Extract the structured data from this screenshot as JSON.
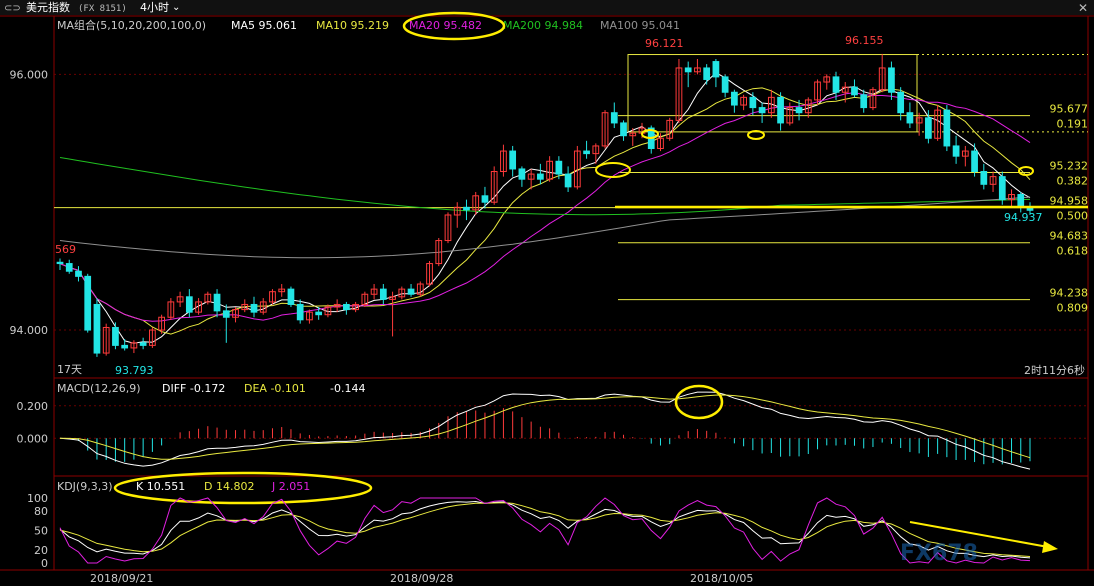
{
  "header": {
    "back_label": "美元指数",
    "code": "(FX 8151)",
    "period": "4小时",
    "period_arrow": "⌄"
  },
  "ma_legend": {
    "prefix": "MA组合(5,10,20,200,100,0)",
    "ma5": "MA5 95.061",
    "ma10": "MA10 95.219",
    "ma20": "MA20 95.482",
    "ma200": "MA200 94.984",
    "ma100": "MA100 95.041"
  },
  "price_axis": {
    "labels": [
      "96.000",
      "94.000"
    ],
    "values": [
      96.0,
      94.0
    ],
    "range": [
      93.75,
      96.3
    ]
  },
  "annotations": {
    "high1": "96.121",
    "high2": "96.155",
    "low_left": "93.793",
    "left_partial": "569",
    "current": "94.937",
    "days": "17天",
    "countdown": "2时11分6秒"
  },
  "fib_levels": [
    {
      "price": "95.677",
      "ratio": "0.191",
      "value": 95.677
    },
    {
      "price": "95.232",
      "ratio": "0.382",
      "value": 95.232
    },
    {
      "price": "94.958",
      "ratio": "0.500",
      "value": 94.958
    },
    {
      "price": "94.683",
      "ratio": "0.618",
      "value": 94.683
    },
    {
      "price": "94.238",
      "ratio": "0.809",
      "value": 94.238
    }
  ],
  "macd": {
    "title": "MACD(12,26,9)",
    "diff": "DIFF -0.172",
    "dea": "DEA -0.101",
    "hist": "-0.144",
    "axis_labels": [
      "0.200",
      "0.000"
    ],
    "axis_values": [
      0.2,
      0.0
    ],
    "range": [
      -0.22,
      0.26
    ]
  },
  "kdj": {
    "title": "KDJ(9,3,3)",
    "k": "K 10.551",
    "d": "D 14.802",
    "j": "J 2.051",
    "axis_labels": [
      "100",
      "80",
      "50",
      "20",
      "0"
    ],
    "axis_values": [
      100,
      80,
      50,
      20,
      0
    ]
  },
  "dates": [
    "2018/09/21",
    "2018/09/28",
    "2018/10/05"
  ],
  "watermark": "FX678",
  "colors": {
    "up": "#ff3b3b",
    "down": "#22e5e5",
    "ma5": "#ffffff",
    "ma10": "#e8e840",
    "ma20": "#e020e0",
    "ma200": "#20c020",
    "ma100": "#909090",
    "fib": "#e8e840",
    "highlight": "#ffee00",
    "grid": "#8b0000"
  },
  "chart_data": {
    "type": "candlestick",
    "title": "美元指数 (FX 8151) 4小时",
    "candles": [
      [
        94.53,
        94.56,
        94.47,
        94.52
      ],
      [
        94.52,
        94.55,
        94.44,
        94.46
      ],
      [
        94.46,
        94.5,
        94.38,
        94.42
      ],
      [
        94.42,
        94.44,
        93.98,
        94.0
      ],
      [
        94.2,
        94.25,
        93.79,
        93.82
      ],
      [
        93.82,
        94.05,
        93.8,
        94.02
      ],
      [
        94.02,
        94.06,
        93.85,
        93.88
      ],
      [
        93.88,
        93.93,
        93.84,
        93.86
      ],
      [
        93.86,
        93.92,
        93.82,
        93.9
      ],
      [
        93.9,
        93.94,
        93.85,
        93.88
      ],
      [
        93.88,
        94.02,
        93.86,
        94.0
      ],
      [
        94.0,
        94.12,
        93.97,
        94.1
      ],
      [
        94.1,
        94.25,
        94.08,
        94.22
      ],
      [
        94.22,
        94.3,
        94.18,
        94.26
      ],
      [
        94.26,
        94.32,
        94.1,
        94.14
      ],
      [
        94.14,
        94.25,
        94.12,
        94.22
      ],
      [
        94.22,
        94.3,
        94.2,
        94.28
      ],
      [
        94.28,
        94.32,
        94.1,
        94.15
      ],
      [
        94.15,
        94.2,
        93.9,
        94.1
      ],
      [
        94.1,
        94.18,
        94.06,
        94.16
      ],
      [
        94.16,
        94.24,
        94.14,
        94.2
      ],
      [
        94.2,
        94.26,
        94.1,
        94.14
      ],
      [
        94.14,
        94.25,
        94.12,
        94.22
      ],
      [
        94.22,
        94.32,
        94.2,
        94.3
      ],
      [
        94.3,
        94.36,
        94.26,
        94.32
      ],
      [
        94.32,
        94.34,
        94.18,
        94.2
      ],
      [
        94.2,
        94.24,
        94.05,
        94.08
      ],
      [
        94.08,
        94.16,
        94.05,
        94.14
      ],
      [
        94.14,
        94.18,
        94.08,
        94.12
      ],
      [
        94.12,
        94.2,
        94.1,
        94.18
      ],
      [
        94.18,
        94.24,
        94.14,
        94.2
      ],
      [
        94.2,
        94.22,
        94.12,
        94.16
      ],
      [
        94.16,
        94.22,
        94.14,
        94.2
      ],
      [
        94.2,
        94.3,
        94.18,
        94.28
      ],
      [
        94.28,
        94.36,
        94.24,
        94.32
      ],
      [
        94.32,
        94.36,
        94.2,
        94.24
      ],
      [
        94.24,
        94.3,
        93.95,
        94.26
      ],
      [
        94.26,
        94.34,
        94.24,
        94.32
      ],
      [
        94.32,
        94.36,
        94.26,
        94.28
      ],
      [
        94.28,
        94.38,
        94.26,
        94.36
      ],
      [
        94.36,
        94.54,
        94.34,
        94.52
      ],
      [
        94.52,
        94.72,
        94.5,
        94.7
      ],
      [
        94.7,
        94.92,
        94.68,
        94.9
      ],
      [
        94.9,
        95.0,
        94.8,
        94.96
      ],
      [
        94.96,
        95.02,
        94.86,
        94.94
      ],
      [
        94.94,
        95.08,
        94.9,
        95.05
      ],
      [
        95.05,
        95.12,
        94.95,
        95.0
      ],
      [
        95.0,
        95.28,
        94.98,
        95.24
      ],
      [
        95.24,
        95.45,
        95.2,
        95.4
      ],
      [
        95.4,
        95.44,
        95.2,
        95.26
      ],
      [
        95.26,
        95.28,
        95.12,
        95.18
      ],
      [
        95.18,
        95.26,
        95.1,
        95.22
      ],
      [
        95.22,
        95.3,
        95.14,
        95.18
      ],
      [
        95.18,
        95.36,
        95.16,
        95.32
      ],
      [
        95.32,
        95.36,
        95.18,
        95.22
      ],
      [
        95.22,
        95.28,
        95.08,
        95.12
      ],
      [
        95.12,
        95.44,
        95.1,
        95.4
      ],
      [
        95.4,
        95.48,
        95.34,
        95.38
      ],
      [
        95.38,
        95.46,
        95.3,
        95.44
      ],
      [
        95.44,
        95.72,
        95.42,
        95.7
      ],
      [
        95.7,
        95.78,
        95.58,
        95.62
      ],
      [
        95.62,
        95.64,
        95.48,
        95.52
      ],
      [
        95.52,
        95.58,
        95.44,
        95.54
      ],
      [
        95.54,
        95.62,
        95.5,
        95.58
      ],
      [
        95.58,
        95.6,
        95.38,
        95.42
      ],
      [
        95.42,
        95.54,
        95.4,
        95.5
      ],
      [
        95.5,
        95.66,
        95.48,
        95.64
      ],
      [
        95.64,
        96.12,
        95.62,
        96.05
      ],
      [
        96.05,
        96.1,
        95.9,
        96.02
      ],
      [
        96.02,
        96.12,
        96.0,
        96.05
      ],
      [
        96.05,
        96.08,
        95.92,
        95.96
      ],
      [
        96.1,
        96.12,
        95.9,
        95.98
      ],
      [
        95.98,
        96.0,
        95.82,
        95.86
      ],
      [
        95.86,
        95.88,
        95.7,
        95.76
      ],
      [
        95.76,
        95.84,
        95.72,
        95.82
      ],
      [
        95.82,
        95.86,
        95.68,
        95.74
      ],
      [
        95.74,
        95.78,
        95.62,
        95.7
      ],
      [
        95.7,
        95.88,
        95.66,
        95.82
      ],
      [
        95.82,
        95.86,
        95.56,
        95.62
      ],
      [
        95.62,
        95.78,
        95.6,
        95.74
      ],
      [
        95.74,
        95.8,
        95.64,
        95.7
      ],
      [
        95.7,
        95.82,
        95.66,
        95.8
      ],
      [
        95.8,
        95.96,
        95.76,
        95.94
      ],
      [
        95.94,
        96.0,
        95.88,
        95.98
      ],
      [
        95.98,
        96.02,
        95.8,
        95.86
      ],
      [
        95.86,
        95.94,
        95.78,
        95.9
      ],
      [
        95.9,
        95.96,
        95.82,
        95.84
      ],
      [
        95.84,
        95.88,
        95.7,
        95.74
      ],
      [
        95.74,
        95.9,
        95.72,
        95.88
      ],
      [
        95.88,
        96.16,
        95.86,
        96.05
      ],
      [
        96.05,
        96.1,
        95.8,
        95.86
      ],
      [
        95.86,
        95.9,
        95.64,
        95.7
      ],
      [
        95.7,
        95.78,
        95.58,
        95.62
      ],
      [
        95.62,
        95.7,
        95.52,
        95.66
      ],
      [
        95.66,
        95.72,
        95.46,
        95.5
      ],
      [
        95.5,
        95.76,
        95.48,
        95.72
      ],
      [
        95.72,
        95.76,
        95.4,
        95.44
      ],
      [
        95.44,
        95.52,
        95.3,
        95.36
      ],
      [
        95.36,
        95.44,
        95.28,
        95.4
      ],
      [
        95.4,
        95.46,
        95.2,
        95.24
      ],
      [
        95.24,
        95.3,
        95.1,
        95.14
      ],
      [
        95.14,
        95.24,
        95.08,
        95.2
      ],
      [
        95.2,
        95.24,
        94.98,
        95.02
      ],
      [
        95.02,
        95.1,
        94.96,
        95.06
      ],
      [
        95.06,
        95.08,
        94.92,
        94.96
      ],
      [
        94.96,
        95.0,
        94.9,
        94.937
      ]
    ],
    "ma_series": [
      "MA5",
      "MA10",
      "MA20",
      "MA200",
      "MA100"
    ],
    "macd": {
      "diff_first": -0.08,
      "dea_first": -0.05,
      "peak_diff": 0.065,
      "last_diff": -0.172,
      "last_dea": -0.101,
      "last_hist": -0.144
    },
    "kdj": {
      "last_k": 10.551,
      "last_d": 14.802,
      "last_j": 2.051
    },
    "x_dates": [
      "2018/09/21",
      "2018/09/28",
      "2018/10/05"
    ]
  }
}
